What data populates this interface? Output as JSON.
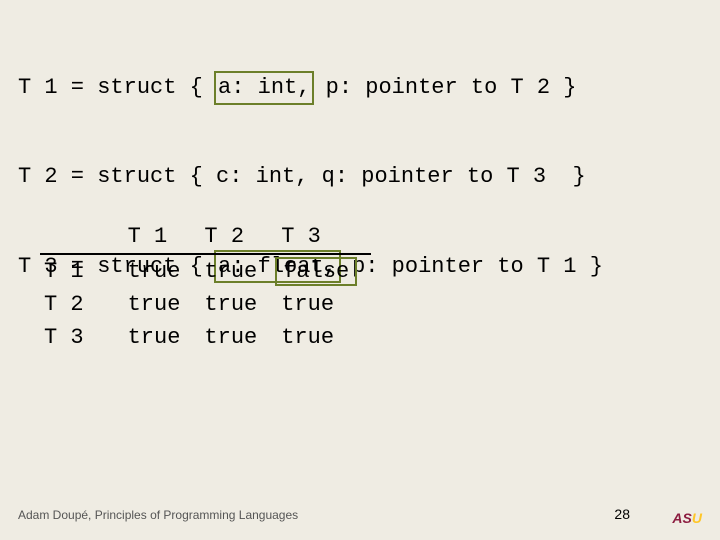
{
  "code": {
    "line1_pre": "T 1 = struct { ",
    "line1_hl": "a: int,",
    "line1_post": " p: pointer to T 2 }",
    "line2": "T 2 = struct { c: int, q: pointer to T 3  }",
    "line3_pre": "T 3 = struct { ",
    "line3_hl": "a: float,",
    "line3_post": " p: pointer to T 1 }"
  },
  "table": {
    "headers": [
      "",
      "T 1",
      "T 2",
      "T 3"
    ],
    "rows": [
      {
        "label": "T 1",
        "cells": [
          "true",
          "true",
          "false"
        ],
        "hl_col": 2
      },
      {
        "label": "T 2",
        "cells": [
          "true",
          "true",
          "true"
        ],
        "hl_col": -1
      },
      {
        "label": "T 3",
        "cells": [
          "true",
          "true",
          "true"
        ],
        "hl_col": -1
      }
    ]
  },
  "footer": "Adam Doupé, Principles of Programming Languages",
  "page": "28",
  "logo": {
    "a": "A",
    "s": "S",
    "u": "U"
  }
}
